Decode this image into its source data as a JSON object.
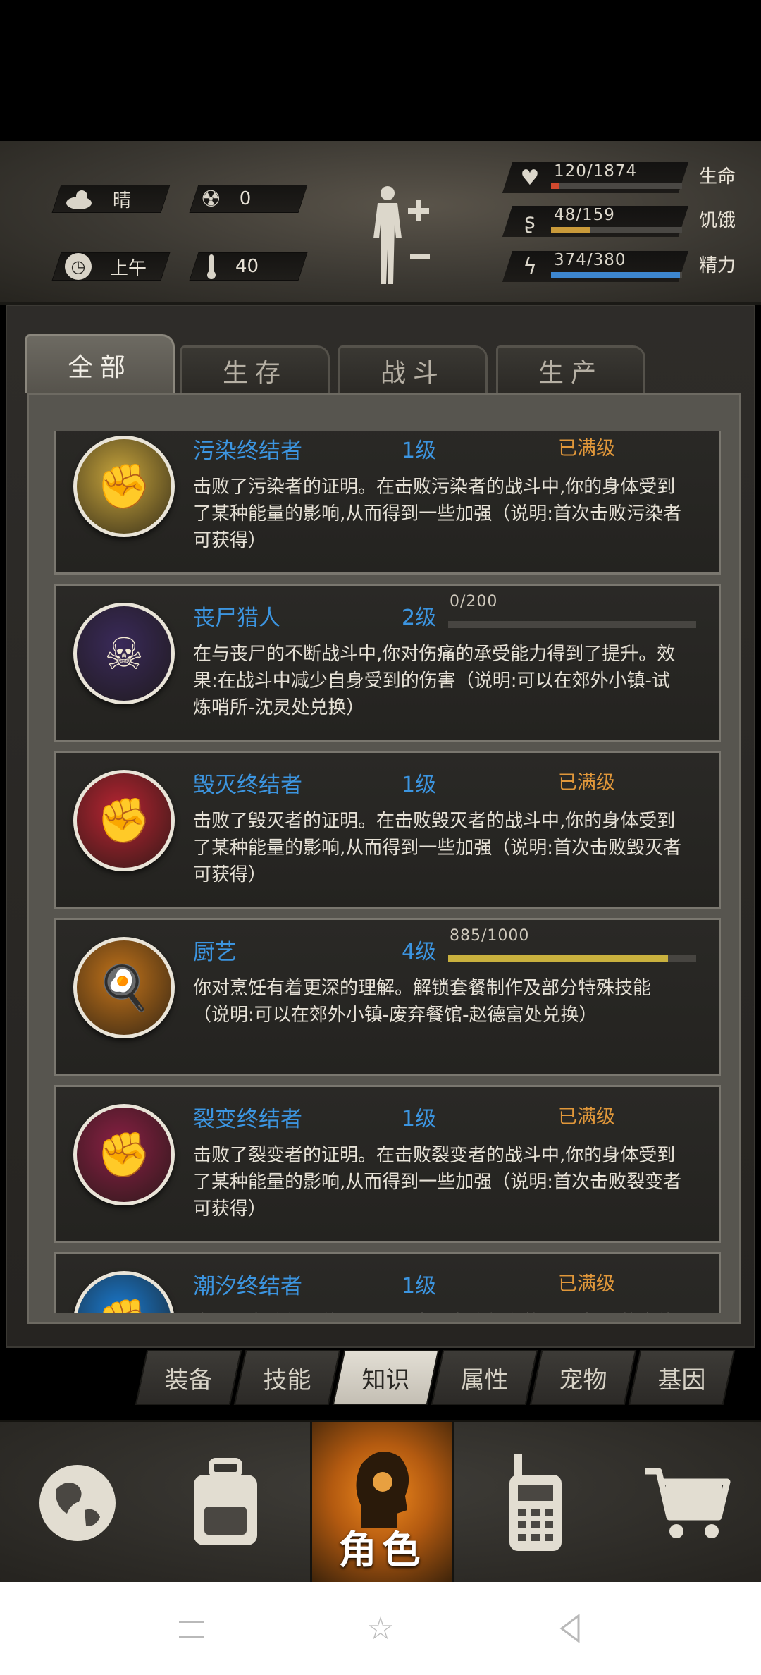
{
  "status": {
    "weather_label": "晴",
    "radiation_value": "0",
    "time_label": "上午",
    "temperature_value": "40",
    "stats": [
      {
        "value": "120/1874",
        "label": "生命",
        "fill": 0.064,
        "color": "#d0492e",
        "icon": "heart-icon"
      },
      {
        "value": "48/159",
        "label": "饥饿",
        "fill": 0.3,
        "color": "#c99a3a",
        "icon": "stomach-icon"
      },
      {
        "value": "374/380",
        "label": "精力",
        "fill": 0.984,
        "color": "#3d86cf",
        "icon": "energy-icon"
      }
    ]
  },
  "tabs": [
    {
      "label": "全部",
      "active": true
    },
    {
      "label": "生存",
      "active": false
    },
    {
      "label": "战斗",
      "active": false
    },
    {
      "label": "生产",
      "active": false
    }
  ],
  "skills": [
    {
      "name": "污染终结者",
      "level": "1级",
      "max_label": "已满级",
      "progress": null,
      "desc": "击败了污染者的证明。在击败污染者的战斗中,你的身体受到了某种能量的影响,从而得到一些加强（说明:首次击败污染者可获得）",
      "badge_color": "#c8a53c",
      "icon": "fist-icon"
    },
    {
      "name": "丧尸猎人",
      "level": "2级",
      "max_label": "",
      "progress": {
        "text": "0/200",
        "fraction": 0.0
      },
      "desc": "在与丧尸的不断战斗中,你对伤痛的承受能力得到了提升。效果:在战斗中减少自身受到的伤害（说明:可以在郊外小镇-试炼哨所-沈灵处兑换）",
      "badge_color": "#3a2a5a",
      "icon": "skull-icon"
    },
    {
      "name": "毁灭终结者",
      "level": "1级",
      "max_label": "已满级",
      "progress": null,
      "desc": "击败了毁灭者的证明。在击败毁灭者的战斗中,你的身体受到了某种能量的影响,从而得到一些加强（说明:首次击败毁灭者可获得）",
      "badge_color": "#b82432",
      "icon": "fist-icon"
    },
    {
      "name": "厨艺",
      "level": "4级",
      "max_label": "",
      "progress": {
        "text": "885/1000",
        "fraction": 0.885
      },
      "desc": "你对烹饪有着更深的理解。解锁套餐制作及部分特殊技能（说明:可以在郊外小镇-废弃餐馆-赵德富处兑换）",
      "badge_color": "#c2731a",
      "icon": "chef-icon"
    },
    {
      "name": "裂变终结者",
      "level": "1级",
      "max_label": "已满级",
      "progress": null,
      "desc": "击败了裂变者的证明。在击败裂变者的战斗中,你的身体受到了某种能量的影响,从而得到一些加强（说明:首次击败裂变者可获得）",
      "badge_color": "#8a2044",
      "icon": "fist-icon"
    },
    {
      "name": "潮汐终结者",
      "level": "1级",
      "max_label": "已满级",
      "progress": null,
      "desc": "击败了潮汐领主的证明。在击败潮汐领主的战斗中,你的身体",
      "badge_color": "#1a7ad0",
      "icon": "fist-icon"
    }
  ],
  "subtabs": [
    {
      "label": "装备",
      "active": false
    },
    {
      "label": "技能",
      "active": false
    },
    {
      "label": "知识",
      "active": true
    },
    {
      "label": "属性",
      "active": false
    },
    {
      "label": "宠物",
      "active": false
    },
    {
      "label": "基因",
      "active": false
    }
  ],
  "bottom_nav": {
    "active_label": "角色",
    "items": [
      "globe-icon",
      "backpack-icon",
      "character-icon",
      "radio-icon",
      "cart-icon"
    ]
  }
}
